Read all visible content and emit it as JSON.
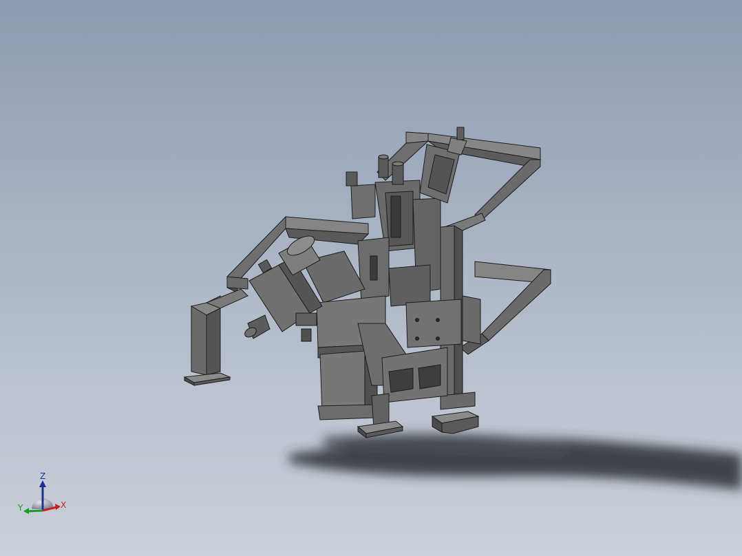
{
  "colors": {
    "background_top": "#8d9bb0",
    "background_bottom": "#c9ced7",
    "part_face": "#6a6a6a",
    "part_top": "#858585",
    "part_dark": "#3f3f3f",
    "edge": "#1e1e1e",
    "shadow": "#2a2d33",
    "axis_x": "#c8201f",
    "axis_y": "#1f9a2a",
    "axis_z": "#1f2f9a"
  },
  "triad": {
    "x_label": "X",
    "y_label": "Y",
    "z_label": "Z"
  },
  "model": {
    "icon": "3d-assembly-model"
  }
}
